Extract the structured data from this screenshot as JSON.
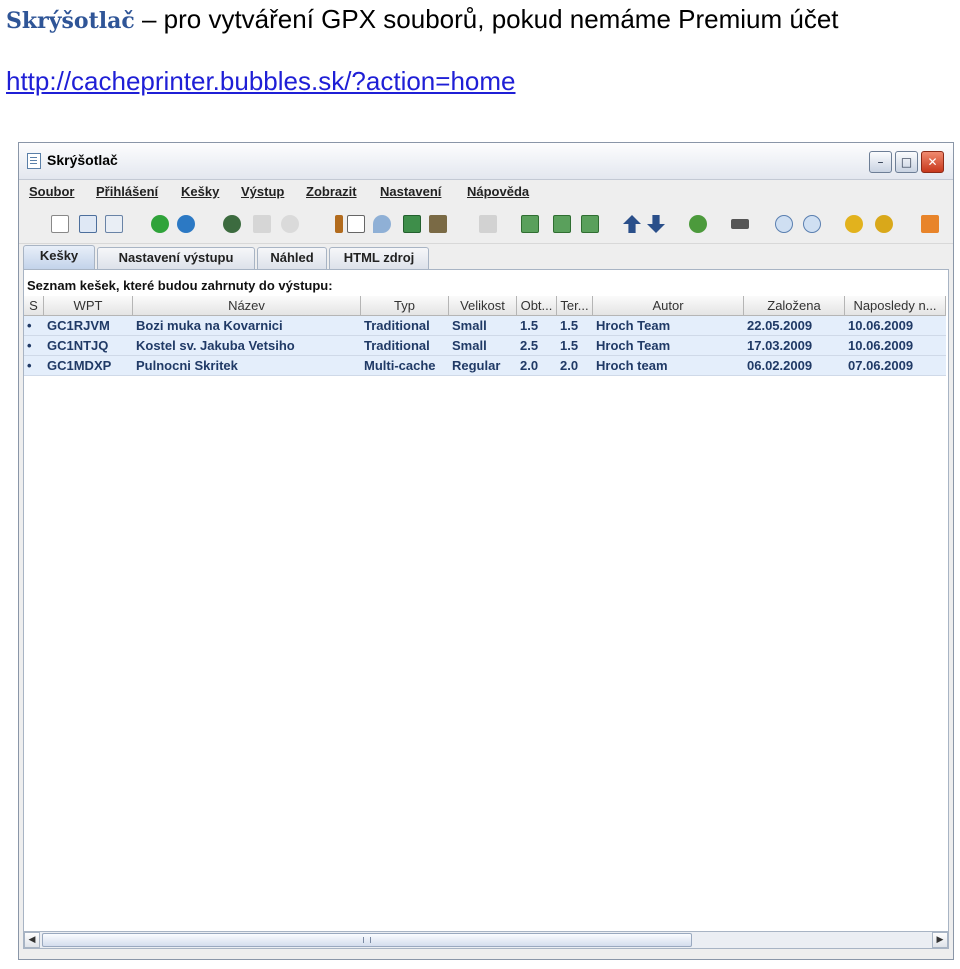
{
  "doc": {
    "title_app": "Skrýšotlač",
    "title_rest": " – pro vytváření GPX souborů, pokud nemáme Premium účet",
    "link": "http://cacheprinter.bubbles.sk/?action=home"
  },
  "window": {
    "title": "Skrýšotlač",
    "controls": {
      "minimize": "–",
      "maximize": "□",
      "close": "✕"
    }
  },
  "menu": [
    "Soubor",
    "Přihlášení",
    "Kešky",
    "Výstup",
    "Zobrazit",
    "Nastavení",
    "Nápověda"
  ],
  "toolbar_icons": [
    "new-file-icon",
    "open-book-icon",
    "copy-icon",
    "green-go-icon",
    "globe-icon",
    "gear-icon",
    "disabled-icon",
    "disabled-icon",
    "bottle-icon",
    "geocaching-icon",
    "search-icon",
    "spreadsheet-icon",
    "filter-icon",
    "disabled-icon",
    "grid-green-icon",
    "grid-green-icon",
    "grid-green-icon",
    "arrow-up-icon",
    "arrow-down-icon",
    "refresh-icon",
    "scissors-icon",
    "circle-blue-icon",
    "circle-blue-icon",
    "help-icon",
    "tip-icon",
    "exit-icon"
  ],
  "tabs": [
    "Kešky",
    "Nastavení výstupu",
    "Náhled",
    "HTML zdroj"
  ],
  "panel": {
    "label": "Seznam kešek, které budou zahrnuty do výstupu:"
  },
  "table": {
    "columns": [
      "S",
      "WPT",
      "Název",
      "Typ",
      "Velikost",
      "Obt...",
      "Ter...",
      "Autor",
      "Založena",
      "Naposledy n..."
    ],
    "rows": [
      [
        "•",
        "GC1RJVM",
        "Bozi muka na Kovarnici",
        "Traditional",
        "Small",
        "1.5",
        "1.5",
        "Hroch Team",
        "22.05.2009",
        "10.06.2009"
      ],
      [
        "•",
        "GC1NTJQ",
        "Kostel sv. Jakuba Vetsiho",
        "Traditional",
        "Small",
        "2.5",
        "1.5",
        "Hroch Team",
        "17.03.2009",
        "10.06.2009"
      ],
      [
        "•",
        "GC1MDXP",
        "Pulnocni Skritek",
        "Multi-cache",
        "Regular",
        "2.0",
        "2.0",
        "Hroch team",
        "06.02.2009",
        "07.06.2009"
      ]
    ]
  },
  "scrollbar": {
    "left": "◀",
    "right": "▶"
  },
  "colors": {
    "accent": "#2f5597",
    "link": "#1f1fd6",
    "row_bg": "#e4eefb",
    "row_text": "#203a66"
  }
}
